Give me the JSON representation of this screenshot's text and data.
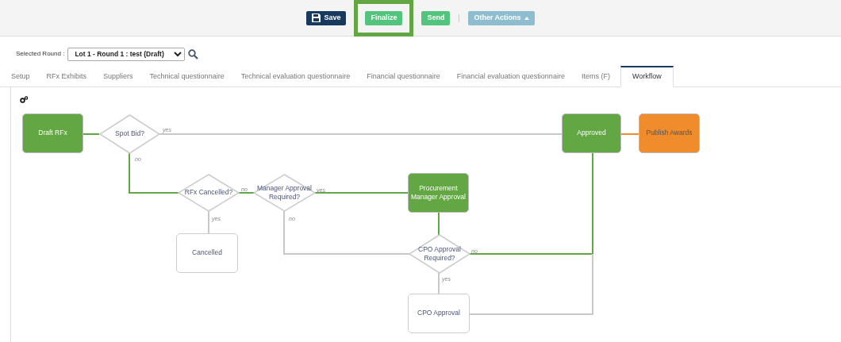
{
  "toolbar": {
    "buttons": [
      {
        "label": "Save",
        "kind": "save",
        "highlighted": false
      },
      {
        "label": "Finalize",
        "kind": "finalize",
        "highlighted": true
      },
      {
        "label": "Send",
        "kind": "send",
        "highlighted": false
      },
      {
        "label": "Other Actions",
        "kind": "menu",
        "highlighted": false
      }
    ]
  },
  "round": {
    "label": "Selected Round :",
    "value": "Lot 1 - Round 1 : test (Draft)"
  },
  "tabs": [
    {
      "label": "Setup",
      "selected": false
    },
    {
      "label": "RFx Exhibits",
      "selected": false
    },
    {
      "label": "Suppliers",
      "selected": false
    },
    {
      "label": "Technical questionnaire",
      "selected": false
    },
    {
      "label": "Technical evaluation questionnaire",
      "selected": false
    },
    {
      "label": "Financial questionnaire",
      "selected": false
    },
    {
      "label": "Financial evaluation questionnaire",
      "selected": false
    },
    {
      "label": "Items (F)",
      "selected": false
    },
    {
      "label": "Workflow",
      "selected": true
    }
  ],
  "workflow": {
    "nodes": [
      {
        "label": "Draft RFx",
        "kind": "process",
        "color": "#62a744"
      },
      {
        "label": "Spot Bid?",
        "kind": "decision"
      },
      {
        "label": "Approved",
        "kind": "process",
        "color": "#62a744"
      },
      {
        "label": "Publish Awards",
        "kind": "process",
        "color": "#f08c2c"
      },
      {
        "label": "RFx Cancelled?",
        "kind": "decision"
      },
      {
        "label": "Manager Approval Required?",
        "kind": "decision"
      },
      {
        "label": "Procurement Manager Approval",
        "kind": "process",
        "color": "#62a744"
      },
      {
        "label": "Cancelled",
        "kind": "process",
        "color": "#ffffff"
      },
      {
        "label": "CPO Approval Required?",
        "kind": "decision"
      },
      {
        "label": "CPO Approval",
        "kind": "process",
        "color": "#ffffff"
      }
    ],
    "edges": [
      {
        "color": "#62a744"
      },
      {
        "label": "yes",
        "color": "#c8c8c8"
      },
      {
        "label": "no",
        "color": "#62a744"
      },
      {
        "label": "no",
        "color": "#62a744"
      },
      {
        "label": "yes",
        "color": "#c8c8c8"
      },
      {
        "label": "yes",
        "color": "#62a744"
      },
      {
        "label": "no",
        "color": "#c8c8c8"
      },
      {
        "color": "#62a744"
      },
      {
        "label": "no",
        "color": "#62a744"
      },
      {
        "label": "yes",
        "color": "#c8c8c8"
      },
      {
        "color": "#c8c8c8"
      },
      {
        "color": "#f08c2c"
      }
    ]
  }
}
